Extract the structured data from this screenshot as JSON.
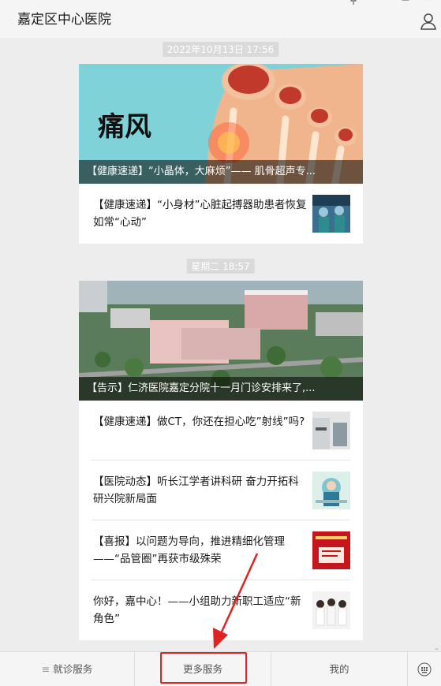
{
  "window": {
    "title": "嘉定区中心医院",
    "controls": [
      "pin-icon",
      "minimize-icon",
      "maximize-icon",
      "close-icon"
    ]
  },
  "feed": {
    "groups": [
      {
        "timestamp": "2022年10月13日  17:56",
        "cover_caption": "【健康速递】“小晶体，大麻烦”—— 肌骨超声专...",
        "cover_text": "痛风",
        "items": [
          {
            "text": "【健康速递】“小身材”心脏起搏器助患者恢复如常“心动”",
            "thumb": "surgery-photo"
          }
        ]
      },
      {
        "timestamp": "星期二  18:57",
        "cover_caption": "【告示】仁济医院嘉定分院十一月门诊安排来了,...",
        "items": [
          {
            "text": "【健康速递】做CT，你还在担心吃”射线”吗?",
            "thumb": "ct-room-photo"
          },
          {
            "text": "【医院动态】听长江学者讲科研 奋力开拓科研兴院新局面",
            "thumb": "lecture-illustration"
          },
          {
            "text": "【喜报】以问题为导向，推进精细化管理——“品管圈”再获市级殊荣",
            "thumb": "award-poster"
          },
          {
            "text": "你好，嘉中心！——小组助力新职工适应“新角色”",
            "thumb": "staff-group-photo"
          }
        ]
      }
    ]
  },
  "bottom_menu": {
    "tab1": "就诊服务",
    "tab2": "更多服务",
    "tab3": "我的"
  },
  "colors": {
    "highlight": "#e02424",
    "arrow": "#e02424",
    "bg": "#ededed"
  }
}
